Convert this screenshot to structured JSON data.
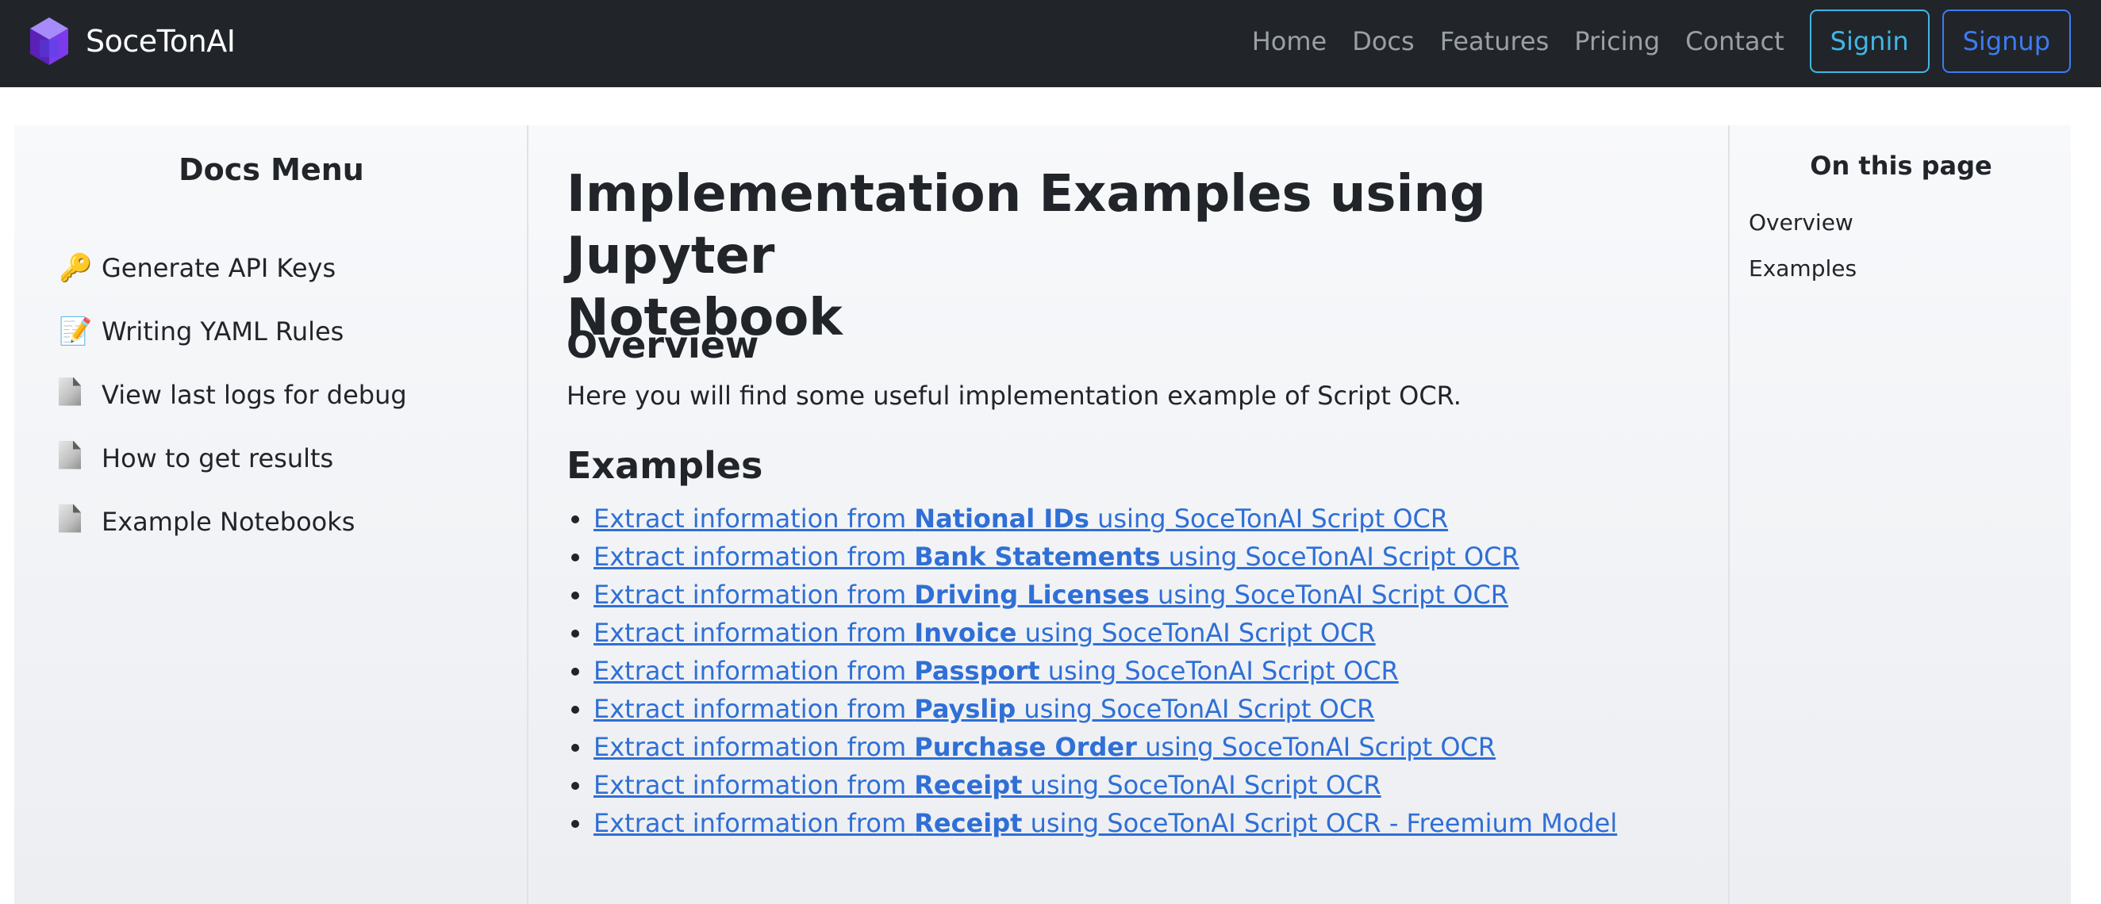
{
  "navbar": {
    "brand": "SoceTonAI",
    "links": [
      "Home",
      "Docs",
      "Features",
      "Pricing",
      "Contact"
    ],
    "signin": "Signin",
    "signup": "Signup",
    "colors": {
      "background": "#212529",
      "signin": "#41b6e6",
      "signup": "#3d7bf3",
      "logo": "#7b3ff2"
    }
  },
  "sidebar": {
    "title": "Docs Menu",
    "items": [
      {
        "icon": "key-icon",
        "label": "Generate API Keys"
      },
      {
        "icon": "memo-icon",
        "label": "Writing YAML Rules"
      },
      {
        "icon": "document-icon",
        "label": "View last logs for debug"
      },
      {
        "icon": "document-icon",
        "label": "How to get results"
      },
      {
        "icon": "document-icon",
        "label": "Example Notebooks"
      }
    ]
  },
  "main": {
    "title_line1": "Implementation Examples using Jupyter",
    "title_line2": "Notebook",
    "overview_heading": "Overview",
    "overview_text": "Here you will find some useful implementation example of Script OCR.",
    "examples_heading": "Examples",
    "examples": [
      {
        "prefix": "Extract information from ",
        "bold": "National IDs",
        "suffix": " using SoceTonAI Script OCR"
      },
      {
        "prefix": "Extract information from ",
        "bold": "Bank Statements",
        "suffix": " using SoceTonAI Script OCR"
      },
      {
        "prefix": "Extract information from ",
        "bold": "Driving Licenses",
        "suffix": " using SoceTonAI Script OCR"
      },
      {
        "prefix": "Extract information from ",
        "bold": "Invoice",
        "suffix": " using SoceTonAI Script OCR"
      },
      {
        "prefix": "Extract information from ",
        "bold": "Passport",
        "suffix": " using SoceTonAI Script OCR"
      },
      {
        "prefix": "Extract information from ",
        "bold": "Payslip",
        "suffix": " using SoceTonAI Script OCR"
      },
      {
        "prefix": "Extract information from ",
        "bold": "Purchase Order",
        "suffix": " using SoceTonAI Script OCR"
      },
      {
        "prefix": "Extract information from ",
        "bold": "Receipt",
        "suffix": " using SoceTonAI Script OCR"
      },
      {
        "prefix": "Extract information from ",
        "bold": "Receipt",
        "suffix": " using SoceTonAI Script OCR - Freemium Model"
      }
    ],
    "link_color": "#2f6fd6"
  },
  "toc": {
    "title": "On this page",
    "items": [
      "Overview",
      "Examples"
    ]
  }
}
